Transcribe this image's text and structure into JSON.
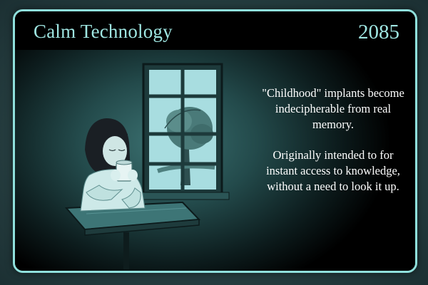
{
  "card": {
    "title": "Calm Technology",
    "year": "2085",
    "caption": {
      "paragraph_1": "\"Childhood\" implants become indecipherable from real memory.",
      "paragraph_2": "Originally intended to for instant access to knowledge, without a need to look it up."
    },
    "illustration": "girl-drinking-from-mug-by-window"
  },
  "colors": {
    "frame_border": "#8fe0dc",
    "title_text": "#9fe6e2",
    "caption_text": "#ffffff",
    "header_bg": "#000000"
  }
}
